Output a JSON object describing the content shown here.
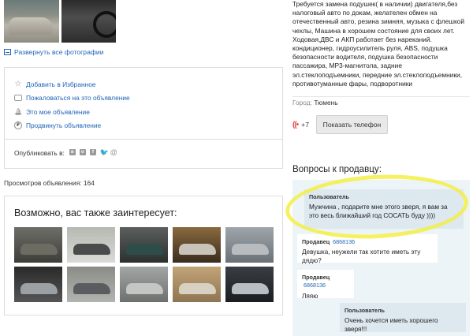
{
  "listing": {
    "expand_photos_label": "Развернуть все фотографии",
    "actions": [
      {
        "icon": "star-icon",
        "label": "Добавить в Избранное"
      },
      {
        "icon": "flag-icon",
        "label": "Пожаловаться на это объявление"
      },
      {
        "icon": "bell-icon",
        "label": "Это мое объявление"
      },
      {
        "icon": "coin-icon",
        "label": "Продвинуть объявление"
      }
    ],
    "share_label": "Опубликовать в:",
    "share_icons": [
      "vk-icon",
      "odnoklassniki-icon",
      "facebook-icon",
      "twitter-icon",
      "mail-icon"
    ],
    "views_label": "Просмотров объявления: 164",
    "similar_title": "Возможно, вас также заинтересует:",
    "similar_count": 10
  },
  "description": {
    "text": "Требуется замена подушек( в наличии) двигателя,без налоговый авто по докам, желателен обмен на отечественный авто, резина зимняя, музыка с флешкой чехлы, Машина в хорошем состояние для своих лет. Ходовая,ДВС и АКП работает без нареканий. кондиционер, гидроусилитель руля, ABS, подушка безопасности водителя, подушка безопасности пассажира, MP3-магнитола, задние эл.стеклоподъемники, передние эл.стеклоподъемники, противотуманные фары, подворотники",
    "city_label": "Город:",
    "city_value": "Тюмень",
    "phone_prefix": "+7",
    "phone_button": "Показать телефон"
  },
  "questions": {
    "title": "Вопросы к продавцу:",
    "messages": [
      {
        "author": "Пользователь",
        "author_id": "",
        "text": "Мужчина , подарите мне этого зверя, я вам за это весь ближайший год СОСАТЬ буду ))))"
      },
      {
        "author": "Продавец",
        "author_id": "6868136",
        "text": "Девушка, неужели так хотите иметь эту дядю?"
      },
      {
        "author": "Продавец",
        "author_id": "6868136",
        "text": "Ляяю"
      },
      {
        "author": "Пользователь",
        "author_id": "",
        "text": "Очень хочется иметь хорошего зверя!!!"
      }
    ]
  },
  "colors": {
    "link": "#2264b8",
    "chat_bg": "#edf4f7",
    "highlight": "#f3ee45",
    "phone_icon": "#e24848"
  }
}
